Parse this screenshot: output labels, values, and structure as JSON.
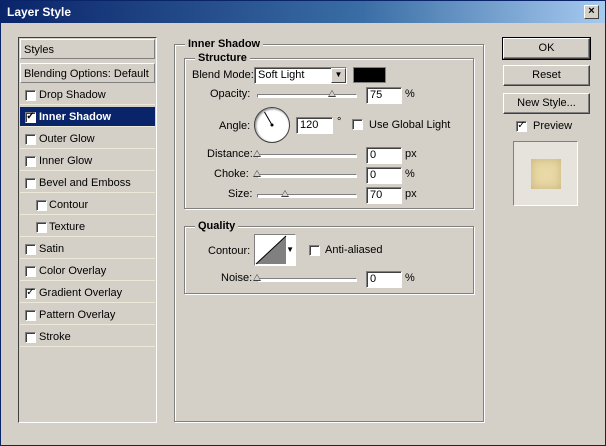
{
  "window": {
    "title": "Layer Style",
    "close": "×"
  },
  "styles": {
    "header": "Styles",
    "blending": "Blending Options: Default",
    "items": [
      {
        "label": "Drop Shadow",
        "checked": false
      },
      {
        "label": "Inner Shadow",
        "checked": true
      },
      {
        "label": "Outer Glow",
        "checked": false
      },
      {
        "label": "Inner Glow",
        "checked": false
      },
      {
        "label": "Bevel and Emboss",
        "checked": false
      },
      {
        "label": "Contour",
        "checked": false
      },
      {
        "label": "Texture",
        "checked": false
      },
      {
        "label": "Satin",
        "checked": false
      },
      {
        "label": "Color Overlay",
        "checked": false
      },
      {
        "label": "Gradient Overlay",
        "checked": true
      },
      {
        "label": "Pattern Overlay",
        "checked": false
      },
      {
        "label": "Stroke",
        "checked": false
      }
    ],
    "selected": "Inner Shadow"
  },
  "inner_shadow": {
    "title": "Inner Shadow",
    "structure": {
      "title": "Structure",
      "blend_mode_label": "Blend Mode:",
      "blend_mode_value": "Soft Light",
      "blend_color": "#000000",
      "opacity_label": "Opacity:",
      "opacity_value": "75",
      "opacity_unit": "%",
      "angle_label": "Angle:",
      "angle_value": "120",
      "angle_unit": "°",
      "global_light_label": "Use Global Light",
      "global_light_checked": false,
      "distance_label": "Distance:",
      "distance_value": "0",
      "distance_unit": "px",
      "choke_label": "Choke:",
      "choke_value": "0",
      "choke_unit": "%",
      "size_label": "Size:",
      "size_value": "70",
      "size_unit": "px"
    },
    "quality": {
      "title": "Quality",
      "contour_label": "Contour:",
      "anti_aliased_label": "Anti-aliased",
      "anti_aliased_checked": false,
      "noise_label": "Noise:",
      "noise_value": "0",
      "noise_unit": "%"
    }
  },
  "buttons": {
    "ok": "OK",
    "reset": "Reset",
    "new_style": "New Style..."
  },
  "preview": {
    "label": "Preview",
    "checked": true,
    "swatch_color": "#e9d9a6"
  }
}
